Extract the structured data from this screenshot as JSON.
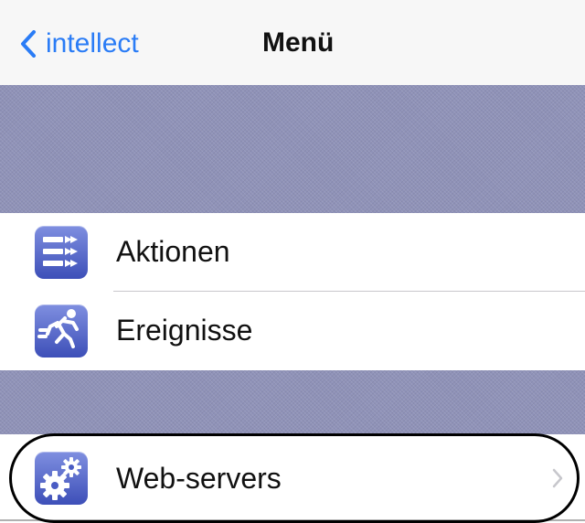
{
  "navbar": {
    "back_label": "intellect",
    "title": "Menü"
  },
  "menu": {
    "items": [
      {
        "label": "Aktionen",
        "icon": "actions-icon"
      },
      {
        "label": "Ereignisse",
        "icon": "running-man-icon"
      },
      {
        "label": "Web-servers",
        "icon": "gears-icon",
        "has_chevron": true
      }
    ]
  },
  "colors": {
    "accent": "#2a7cf6",
    "section_band": "#8f92b8",
    "icon_gradient_top": "#7f8fe0",
    "icon_gradient_bottom": "#3d4fb8",
    "highlight_outline": "#000000"
  }
}
